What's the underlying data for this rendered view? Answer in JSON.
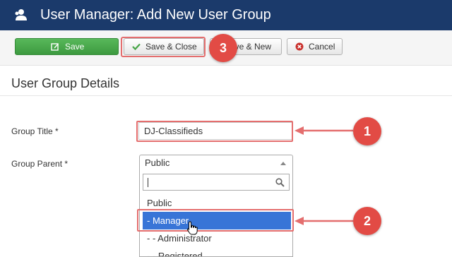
{
  "header": {
    "title": "User Manager: Add New User Group",
    "icon": "users-icon"
  },
  "toolbar": {
    "save_label": "Save",
    "save_close_label": "Save & Close",
    "save_new_label": "Save & New",
    "save_new_visible_label": "ave & New",
    "cancel_label": "Cancel"
  },
  "section": {
    "title": "User Group Details"
  },
  "form": {
    "group_title_label": "Group Title *",
    "group_title_value": "DJ-Classifieds",
    "group_parent_label": "Group Parent *",
    "group_parent_selected": "Public",
    "dropdown_options": [
      "Public",
      "- Manager",
      "- - Administrator",
      "- - Registered"
    ],
    "highlighted_option_index": 1
  },
  "annotations": {
    "step1": "1",
    "step2": "2",
    "step3": "3"
  },
  "colors": {
    "header_bg": "#1b3a6b",
    "save_green": "#46a546",
    "highlight_blue": "#3875d7",
    "annotation_red": "#e24b45"
  }
}
